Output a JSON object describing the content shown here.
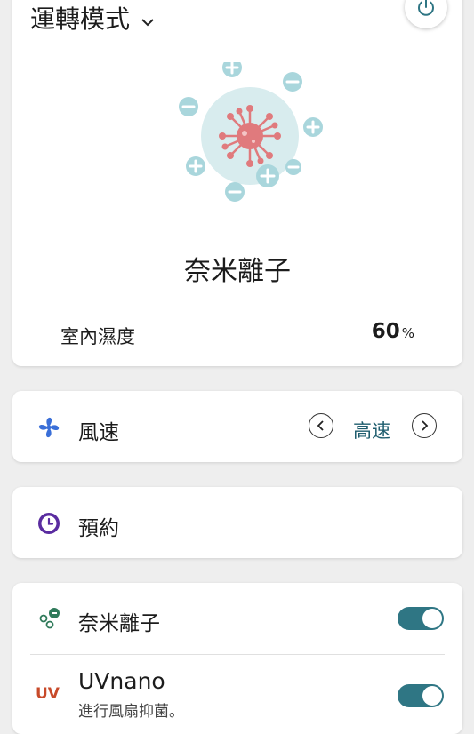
{
  "mode": {
    "title": "運轉模式",
    "name": "奈米離子"
  },
  "humidity": {
    "label": "室內濕度",
    "value": "60",
    "unit": "%"
  },
  "fan": {
    "label": "風速",
    "value": "高速"
  },
  "schedule": {
    "label": "預約"
  },
  "features": {
    "nanoion": {
      "label": "奈米離子",
      "on": true
    },
    "uvnano": {
      "icon_text": "UV",
      "label": "UVnano",
      "subtitle": "進行風扇抑菌。",
      "on": true
    }
  },
  "colors": {
    "accent": "#2f7684",
    "virus": "#e07a7d",
    "ion": "#a9d6dc",
    "fan_icon": "#3a6fd8",
    "schedule_icon": "#5a2ca0",
    "uv": "#c84a2a"
  }
}
